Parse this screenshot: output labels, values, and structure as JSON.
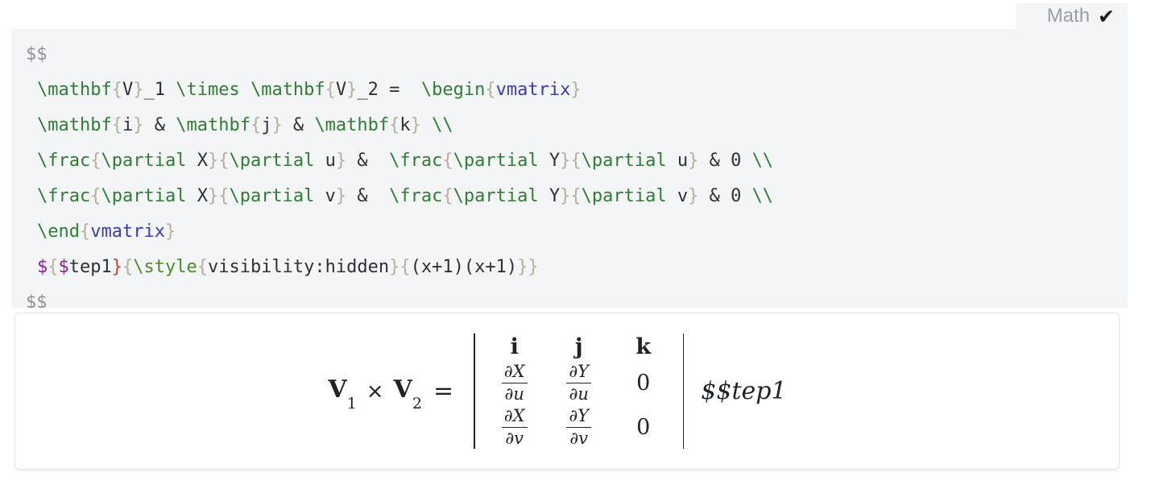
{
  "toolbar": {
    "math_label": "Math",
    "math_checked_glyph": "✔",
    "math_enabled": true
  },
  "editor": {
    "background_color": "#f4f5f7",
    "language": "latex",
    "source_text": "$$\n \\mathbf{V}_1 \\times \\mathbf{V}_2 =  \\begin{vmatrix}\n \\mathbf{i} & \\mathbf{j} & \\mathbf{k} \\\\\n \\frac{\\partial X}{\\partial u} &  \\frac{\\partial Y}{\\partial u} & 0 \\\\\n \\frac{\\partial X}{\\partial v} &  \\frac{\\partial Y}{\\partial v} & 0 \\\\\n \\end{vmatrix}\n ${$tep1}{\\style{visibility:hidden}{(x+1)(x+1)}}\n$$",
    "lines": [
      {
        "id": "l1",
        "indent": false,
        "tokens": [
          {
            "t": "$$",
            "c": "t-dollar-gray"
          }
        ]
      },
      {
        "id": "l2",
        "indent": true,
        "tokens": [
          {
            "t": "\\mathbf",
            "c": "t-cmd"
          },
          {
            "t": "{",
            "c": "t-brace"
          },
          {
            "t": "V",
            "c": "t-plain"
          },
          {
            "t": "}",
            "c": "t-brace"
          },
          {
            "t": "_1 ",
            "c": "t-plain"
          },
          {
            "t": "\\times",
            "c": "t-cmd"
          },
          {
            "t": " ",
            "c": "t-plain"
          },
          {
            "t": "\\mathbf",
            "c": "t-cmd"
          },
          {
            "t": "{",
            "c": "t-brace"
          },
          {
            "t": "V",
            "c": "t-plain"
          },
          {
            "t": "}",
            "c": "t-brace"
          },
          {
            "t": "_2 =  ",
            "c": "t-plain"
          },
          {
            "t": "\\begin",
            "c": "t-cmd"
          },
          {
            "t": "{",
            "c": "t-brace"
          },
          {
            "t": "vmatrix",
            "c": "t-env"
          },
          {
            "t": "}",
            "c": "t-brace"
          }
        ]
      },
      {
        "id": "l3",
        "indent": true,
        "tokens": [
          {
            "t": "\\mathbf",
            "c": "t-cmd"
          },
          {
            "t": "{",
            "c": "t-brace"
          },
          {
            "t": "i",
            "c": "t-plain"
          },
          {
            "t": "}",
            "c": "t-brace"
          },
          {
            "t": " & ",
            "c": "t-plain"
          },
          {
            "t": "\\mathbf",
            "c": "t-cmd"
          },
          {
            "t": "{",
            "c": "t-brace"
          },
          {
            "t": "j",
            "c": "t-plain"
          },
          {
            "t": "}",
            "c": "t-brace"
          },
          {
            "t": " & ",
            "c": "t-plain"
          },
          {
            "t": "\\mathbf",
            "c": "t-cmd"
          },
          {
            "t": "{",
            "c": "t-brace"
          },
          {
            "t": "k",
            "c": "t-plain"
          },
          {
            "t": "}",
            "c": "t-brace"
          },
          {
            "t": " ",
            "c": "t-plain"
          },
          {
            "t": "\\\\",
            "c": "t-cmd"
          }
        ]
      },
      {
        "id": "l4",
        "indent": true,
        "tokens": [
          {
            "t": "\\frac",
            "c": "t-cmd"
          },
          {
            "t": "{",
            "c": "t-brace"
          },
          {
            "t": "\\partial",
            "c": "t-cmd"
          },
          {
            "t": " X",
            "c": "t-plain"
          },
          {
            "t": "}",
            "c": "t-brace"
          },
          {
            "t": "{",
            "c": "t-brace"
          },
          {
            "t": "\\partial",
            "c": "t-cmd"
          },
          {
            "t": " u",
            "c": "t-plain"
          },
          {
            "t": "}",
            "c": "t-brace"
          },
          {
            "t": " &  ",
            "c": "t-plain"
          },
          {
            "t": "\\frac",
            "c": "t-cmd"
          },
          {
            "t": "{",
            "c": "t-brace"
          },
          {
            "t": "\\partial",
            "c": "t-cmd"
          },
          {
            "t": " Y",
            "c": "t-plain"
          },
          {
            "t": "}",
            "c": "t-brace"
          },
          {
            "t": "{",
            "c": "t-brace"
          },
          {
            "t": "\\partial",
            "c": "t-cmd"
          },
          {
            "t": " u",
            "c": "t-plain"
          },
          {
            "t": "}",
            "c": "t-brace"
          },
          {
            "t": " & 0 ",
            "c": "t-plain"
          },
          {
            "t": "\\\\",
            "c": "t-cmd"
          }
        ]
      },
      {
        "id": "l5",
        "indent": true,
        "tokens": [
          {
            "t": "\\frac",
            "c": "t-cmd"
          },
          {
            "t": "{",
            "c": "t-brace"
          },
          {
            "t": "\\partial",
            "c": "t-cmd"
          },
          {
            "t": " X",
            "c": "t-plain"
          },
          {
            "t": "}",
            "c": "t-brace"
          },
          {
            "t": "{",
            "c": "t-brace"
          },
          {
            "t": "\\partial",
            "c": "t-cmd"
          },
          {
            "t": " v",
            "c": "t-plain"
          },
          {
            "t": "}",
            "c": "t-brace"
          },
          {
            "t": " &  ",
            "c": "t-plain"
          },
          {
            "t": "\\frac",
            "c": "t-cmd"
          },
          {
            "t": "{",
            "c": "t-brace"
          },
          {
            "t": "\\partial",
            "c": "t-cmd"
          },
          {
            "t": " Y",
            "c": "t-plain"
          },
          {
            "t": "}",
            "c": "t-brace"
          },
          {
            "t": "{",
            "c": "t-brace"
          },
          {
            "t": "\\partial",
            "c": "t-cmd"
          },
          {
            "t": " v",
            "c": "t-plain"
          },
          {
            "t": "}",
            "c": "t-brace"
          },
          {
            "t": " & 0 ",
            "c": "t-plain"
          },
          {
            "t": "\\\\",
            "c": "t-cmd"
          }
        ]
      },
      {
        "id": "l6",
        "indent": true,
        "tokens": [
          {
            "t": "\\end",
            "c": "t-cmd"
          },
          {
            "t": "{",
            "c": "t-brace"
          },
          {
            "t": "vmatrix",
            "c": "t-env"
          },
          {
            "t": "}",
            "c": "t-brace"
          }
        ]
      },
      {
        "id": "l7",
        "indent": true,
        "tokens": [
          {
            "t": "$",
            "c": "t-dollar-mag"
          },
          {
            "t": "{",
            "c": "t-brace"
          },
          {
            "t": "$",
            "c": "t-dollar-mag"
          },
          {
            "t": "tep1",
            "c": "t-plain"
          },
          {
            "t": "}",
            "c": "t-brace-red"
          },
          {
            "t": "{",
            "c": "t-brace"
          },
          {
            "t": "\\style",
            "c": "t-style"
          },
          {
            "t": "{",
            "c": "t-brace"
          },
          {
            "t": "visibility:hidden",
            "c": "t-plain"
          },
          {
            "t": "}",
            "c": "t-brace"
          },
          {
            "t": "{",
            "c": "t-brace"
          },
          {
            "t": "(x+1)(x+1)",
            "c": "t-plain"
          },
          {
            "t": "}",
            "c": "t-brace"
          },
          {
            "t": "}",
            "c": "t-brace"
          }
        ]
      },
      {
        "id": "l8",
        "indent": false,
        "tokens": [
          {
            "t": "$$",
            "c": "t-dollar-gray"
          }
        ]
      }
    ]
  },
  "preview": {
    "background_color": "#ffffff",
    "border_color": "#e3e4e8",
    "lhs": {
      "v1": "V",
      "v1_sub": "1",
      "times": "×",
      "v2": "V",
      "v2_sub": "2",
      "equals": "="
    },
    "matrix": {
      "delimiter": "vmatrix",
      "rows": [
        [
          {
            "kind": "unit",
            "text": "i"
          },
          {
            "kind": "unit",
            "text": "j"
          },
          {
            "kind": "unit",
            "text": "k"
          }
        ],
        [
          {
            "kind": "frac",
            "num": "∂X",
            "den": "∂u"
          },
          {
            "kind": "frac",
            "num": "∂Y",
            "den": "∂u"
          },
          {
            "kind": "zero",
            "text": "0"
          }
        ],
        [
          {
            "kind": "frac",
            "num": "∂X",
            "den": "∂v"
          },
          {
            "kind": "frac",
            "num": "∂Y",
            "den": "∂v"
          },
          {
            "kind": "zero",
            "text": "0"
          }
        ]
      ]
    },
    "trailing_text": "$$tep1"
  },
  "colors": {
    "panel_bg": "#f4f5f7",
    "command_green": "#2e7d32",
    "brace_tan": "#b5b09a",
    "env_blue": "#3b3bb0",
    "dollar_magenta": "#8b1f9e",
    "brace_red": "#d33c2f",
    "text_dark": "#2e3134",
    "muted_gray": "#8c9196"
  }
}
